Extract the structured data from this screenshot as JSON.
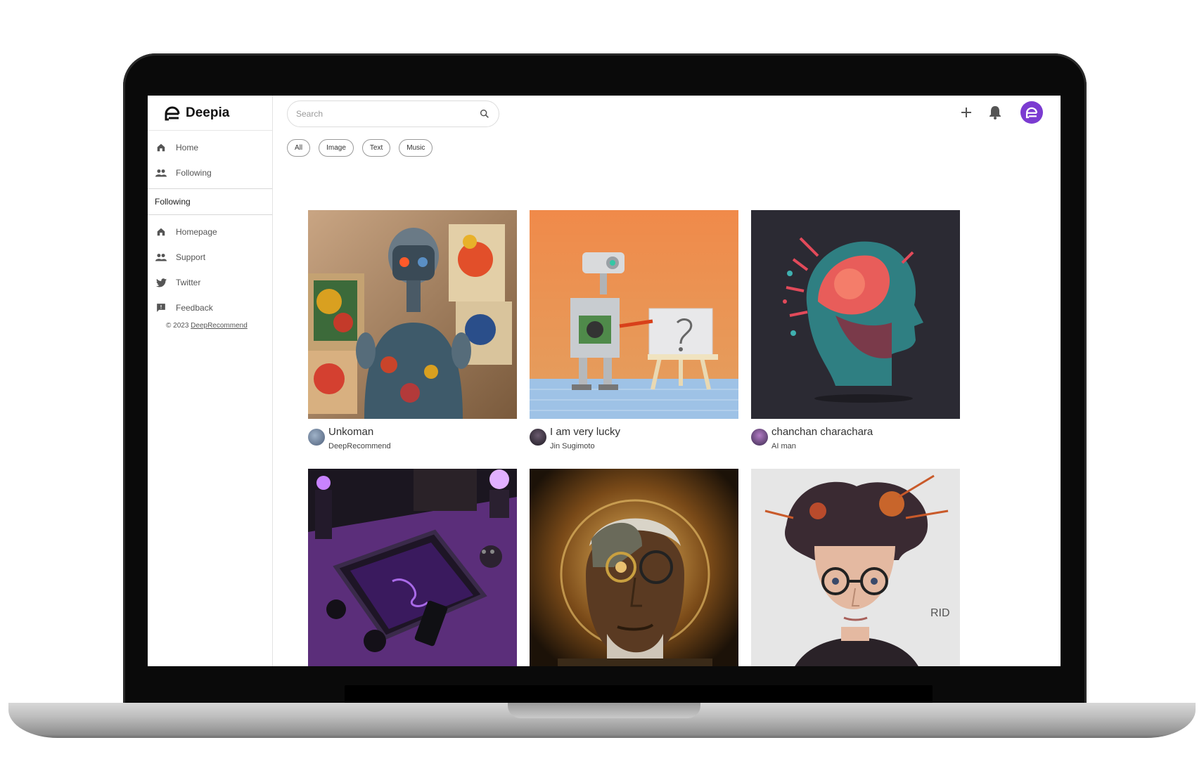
{
  "app": {
    "name": "Deepia"
  },
  "sidebar": {
    "nav": [
      {
        "label": "Home",
        "icon": "home-icon"
      },
      {
        "label": "Following",
        "icon": "people-icon"
      }
    ],
    "section_title": "Following",
    "links": [
      {
        "label": "Homepage",
        "icon": "home-icon"
      },
      {
        "label": "Support",
        "icon": "people-icon"
      },
      {
        "label": "Twitter",
        "icon": "twitter-icon"
      },
      {
        "label": "Feedback",
        "icon": "feedback-icon"
      }
    ],
    "copyright_prefix": "© 2023 ",
    "copyright_link": "DeepRecommend"
  },
  "header": {
    "search_placeholder": "Search",
    "actions": [
      "plus-icon",
      "bell-icon",
      "avatar"
    ]
  },
  "filters": [
    "All",
    "Image",
    "Text",
    "Music"
  ],
  "feed": [
    {
      "title": "Unkoman",
      "author": "DeepRecommend",
      "image": "robot-with-paintings"
    },
    {
      "title": "I am very lucky",
      "author": "Jin Sugimoto",
      "image": "toy-robot-painting-easel"
    },
    {
      "title": "chanchan characharа",
      "author": "AI man",
      "image": "colorful-head-explosion"
    },
    {
      "title": "",
      "author": "",
      "image": "purple-gaming-desk"
    },
    {
      "title": "",
      "author": "",
      "image": "cyborg-old-man"
    },
    {
      "title": "",
      "author": "",
      "image": "young-man-glasses-ink"
    }
  ],
  "colors": {
    "accent": "#7b3bd1",
    "text": "#333333",
    "border": "#dcdcdc"
  }
}
